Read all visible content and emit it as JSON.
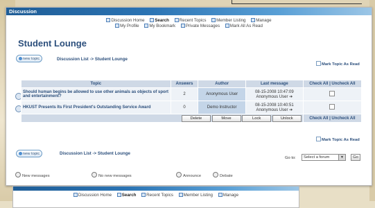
{
  "window": {
    "title": "Discussion"
  },
  "nav": {
    "row1": [
      {
        "icon": "home-icon",
        "label": "Discussion Home",
        "bold": false
      },
      {
        "icon": "search-icon",
        "label": "Search",
        "bold": true
      },
      {
        "icon": "recent-topics-icon",
        "label": "Recent Topics",
        "bold": false
      },
      {
        "icon": "member-listing-icon",
        "label": "Member Listing",
        "bold": false
      },
      {
        "icon": "manage-icon",
        "label": "Manage",
        "bold": false
      }
    ],
    "row2": [
      {
        "icon": "profile-icon",
        "label": "My Profile"
      },
      {
        "icon": "bookmark-icon",
        "label": "My Bookmark"
      },
      {
        "icon": "private-messages-icon",
        "label": "Private Messages"
      },
      {
        "icon": "mark-read-icon",
        "label": "Mark All As Read"
      }
    ]
  },
  "page": {
    "title": "Student Lounge",
    "new_topic_label": "new topic",
    "breadcrumb": "Discussion List -> Student Lounge",
    "mark_topic_read": "Mark Topic As Read"
  },
  "table": {
    "headers": [
      "Topic",
      "Answers",
      "Author",
      "Last message",
      "Check All",
      "Uncheck All"
    ],
    "rows": [
      {
        "topic": "Should human begins be allowed to use other animals as objects of sport and entertainment?",
        "answers": "2",
        "author": "Anonymous User",
        "last_date": "08-15-2008 10:47:09",
        "last_user": "Anonymous User"
      },
      {
        "topic": "HKUST Presents Its First President's Outstanding Service Award",
        "answers": "0",
        "author": "Demo Instructor",
        "last_date": "08-15-2008 10:40:51",
        "last_user": "Anonymous User"
      }
    ],
    "buttons": {
      "delete": "Delete",
      "move": "Move",
      "lock": "Lock",
      "unlock": "Unlock"
    }
  },
  "footer": {
    "goto_label": "Go to:",
    "forum_select": "Select a forum",
    "go_label": "Go"
  },
  "legend": [
    {
      "icon": "new-messages-icon",
      "label": "New messages"
    },
    {
      "icon": "no-new-messages-icon",
      "label": "No new messages"
    },
    {
      "icon": "announce-icon",
      "label": "Announce"
    },
    {
      "icon": "debate-icon",
      "label": "Debate"
    }
  ],
  "colors": {
    "titlebar": "#2b74b4",
    "accent": "#2c4f7c",
    "header_bg": "#cfd9e6",
    "row_bg": "#eef2f7"
  }
}
